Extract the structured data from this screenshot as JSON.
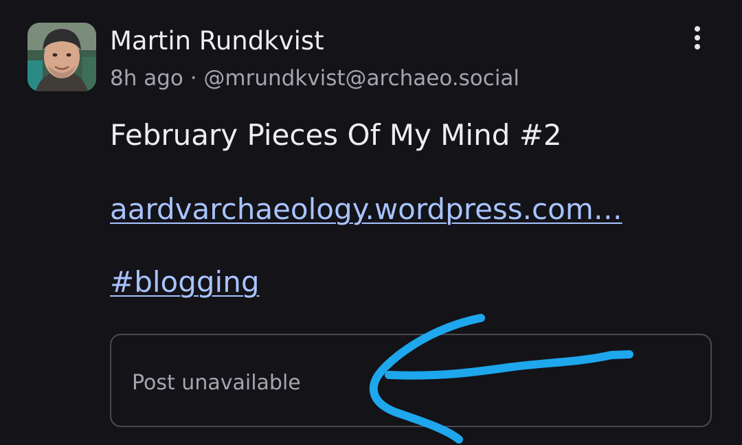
{
  "post": {
    "author": {
      "display_name": "Martin Rundkvist",
      "avatar_icon": "user-avatar-photo"
    },
    "meta": {
      "time_ago": "8h ago",
      "separator": "·",
      "handle": "@mrundkvist@archaeo.social",
      "text": "8h ago · @mrundkvist@archaeo.social"
    },
    "menu_icon": "more-vertical-icon",
    "title": "February Pieces Of My Mind #2",
    "link_text": "aardvarchaeology.wordpress.com…",
    "hashtag": "#blogging",
    "quoted_post": {
      "status_text": "Post unavailable"
    }
  },
  "annotation": {
    "type": "hand-drawn arrow",
    "color": "#1ea7ec"
  },
  "colors": {
    "background": "#131318",
    "primary_text": "#eeedf3",
    "secondary_text": "#a6a5ae",
    "link": "#a9c3ff",
    "border": "#4a4a52"
  }
}
